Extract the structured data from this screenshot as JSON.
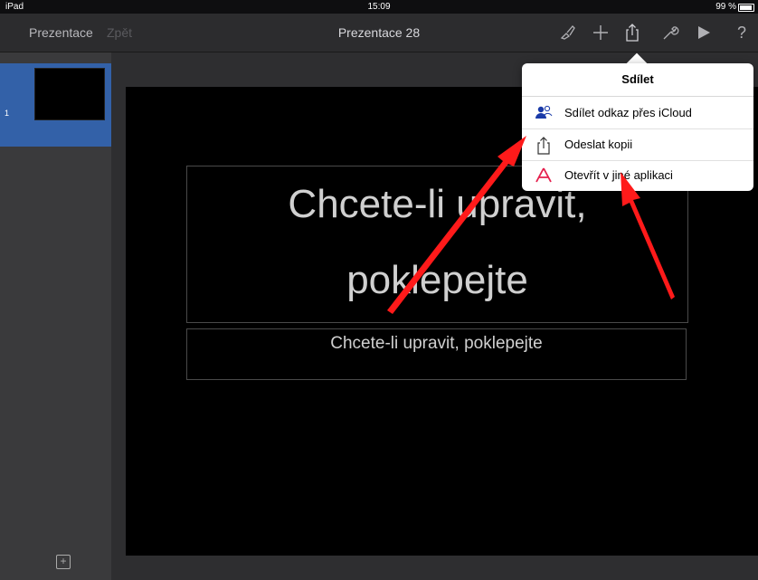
{
  "status_bar": {
    "device": "iPad",
    "time": "15:09",
    "battery": "99 %"
  },
  "toolbar": {
    "back_label": "Prezentace",
    "undo_label": "Zpět",
    "title": "Prezentace 28",
    "icons": [
      "paintbrush-icon",
      "plus-icon",
      "share-icon",
      "wrench-icon",
      "play-icon",
      "help-icon"
    ],
    "help_glyph": "?"
  },
  "sidebar": {
    "slides": [
      {
        "number": "1"
      }
    ],
    "add_glyph": "+"
  },
  "slide": {
    "title_placeholder_line1": "Chcete-li upravit,",
    "title_placeholder_line2": "poklepejte",
    "subtitle_placeholder": "Chcete-li upravit, poklepejte"
  },
  "share_popover": {
    "title": "Sdílet",
    "items": [
      {
        "label": "Sdílet odkaz přes iCloud",
        "icon": "people-icon"
      },
      {
        "label": "Odeslat kopii",
        "icon": "share-icon"
      },
      {
        "label": "Otevřít v jiné aplikaci",
        "icon": "app-icon"
      }
    ]
  },
  "colors": {
    "toolbar_bg": "#2c2c2e",
    "sidebar_bg": "#3a3a3c",
    "selected_thumb": "#3361a8",
    "annotation_arrow": "#ff1a1a",
    "icloud_icon": "#1a3aa8",
    "app_icon": "#e5204e"
  }
}
